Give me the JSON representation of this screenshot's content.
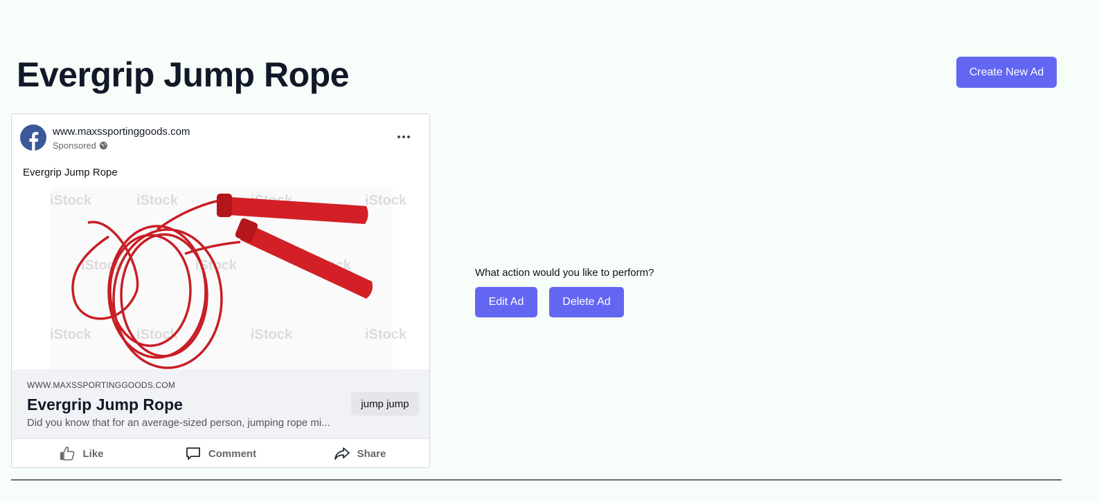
{
  "page": {
    "title": "Evergrip Jump Rope",
    "create_button": "Create New Ad"
  },
  "ad": {
    "advertiser": "www.maxssportinggoods.com",
    "sponsored_label": "Sponsored",
    "primary_text": "Evergrip Jump Rope",
    "link": {
      "domain": "WWW.MAXSSPORTINGGOODS.COM",
      "title": "Evergrip Jump Rope",
      "description": "Did you know that for an average-sized person, jumping rope mi...",
      "cta_label": "jump jump"
    },
    "actions": {
      "like": "Like",
      "comment": "Comment",
      "share": "Share"
    },
    "image": {
      "subject": "red jump rope",
      "watermark": "iStock"
    }
  },
  "action_panel": {
    "prompt": "What action would you like to perform?",
    "edit_label": "Edit Ad",
    "delete_label": "Delete Ad"
  },
  "colors": {
    "background": "#f7fdf9",
    "accent": "#6366f1",
    "facebook_blue": "#3b5998",
    "rope_red": "#d32027"
  }
}
